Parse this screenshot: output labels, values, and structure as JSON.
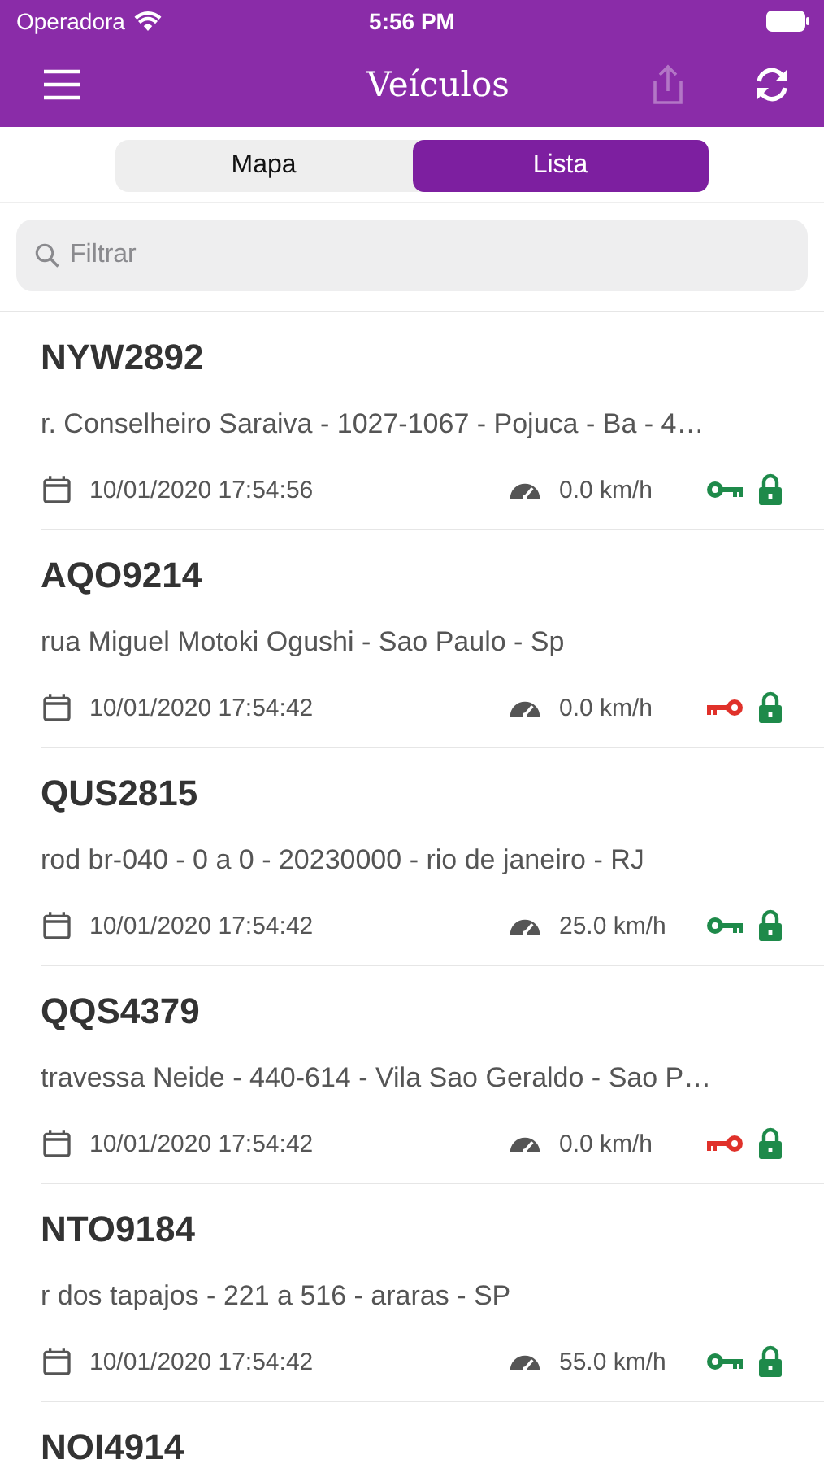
{
  "status_bar": {
    "carrier": "Operadora",
    "time": "5:56 PM"
  },
  "nav": {
    "title": "Veículos",
    "share_disabled": true
  },
  "segments": [
    {
      "label": "Mapa",
      "selected": false
    },
    {
      "label": "Lista",
      "selected": true
    }
  ],
  "search": {
    "placeholder": "Filtrar"
  },
  "vehicles": [
    {
      "plate": "NYW2892",
      "address": "r. Conselheiro Saraiva - 1027-1067 - Pojuca - Ba - 4…",
      "datetime": "10/01/2020 17:54:56",
      "speed": "0.0 km/h",
      "ignition_on": true,
      "blocked": false
    },
    {
      "plate": "AQO9214",
      "address": "rua Miguel Motoki Ogushi - Sao Paulo - Sp",
      "datetime": "10/01/2020 17:54:42",
      "speed": "0.0 km/h",
      "ignition_on": false,
      "blocked": false
    },
    {
      "plate": "QUS2815",
      "address": "rod br-040 - 0 a 0 - 20230000 - rio de janeiro - RJ",
      "datetime": "10/01/2020 17:54:42",
      "speed": "25.0 km/h",
      "ignition_on": true,
      "blocked": false
    },
    {
      "plate": "QQS4379",
      "address": "travessa Neide - 440-614 - Vila Sao Geraldo - Sao P…",
      "datetime": "10/01/2020 17:54:42",
      "speed": "0.0 km/h",
      "ignition_on": false,
      "blocked": false
    },
    {
      "plate": "NTO9184",
      "address": "r dos tapajos - 221 a 516 - araras - SP",
      "datetime": "10/01/2020 17:54:42",
      "speed": "55.0 km/h",
      "ignition_on": true,
      "blocked": false
    },
    {
      "plate": "NOI4914"
    }
  ]
}
